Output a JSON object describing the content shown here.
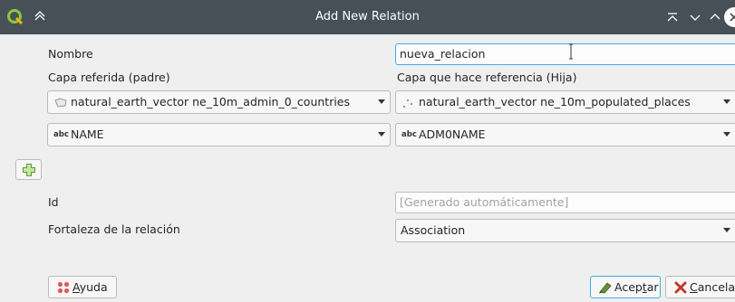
{
  "window": {
    "title": "Add New Relation"
  },
  "form": {
    "name_label": "Nombre",
    "name_value": "nueva_relacion",
    "parent_label": "Capa referida (padre)",
    "child_label": "Capa que hace referencia (Hija)",
    "parent_layer": "natural_earth_vector ne_10m_admin_0_countries",
    "child_layer": "natural_earth_vector ne_10m_populated_places",
    "field_type_badge": "abc",
    "parent_field": "NAME",
    "child_field": "ADM0NAME",
    "id_label": "Id",
    "id_placeholder": "[Generado automáticamente]",
    "strength_label": "Fortaleza de la relación",
    "strength_value": "Association"
  },
  "buttons": {
    "help_label": "Ayuda",
    "help_mnemonic": "A",
    "help_rest": "yuda",
    "accept_label": "Aceptar",
    "accept_pre": "Acep",
    "accept_mnemonic": "t",
    "accept_post": "ar",
    "cancel_label": "Cancelar",
    "cancel_mnemonic": "C",
    "cancel_rest": "ancelar"
  },
  "icons": {
    "app": "qgis-logo-icon",
    "keep_above": "keep-above-icon",
    "polygon_layer": "polygon-layer-icon",
    "point_layer": "point-layer-icon",
    "add": "add-icon",
    "help": "help-icon",
    "accept": "accept-icon",
    "cancel": "cancel-icon"
  },
  "colors": {
    "titlebar": "#475057",
    "focus": "#3daee9",
    "add_green": "#5aa028",
    "cancel_red": "#c0392b"
  }
}
